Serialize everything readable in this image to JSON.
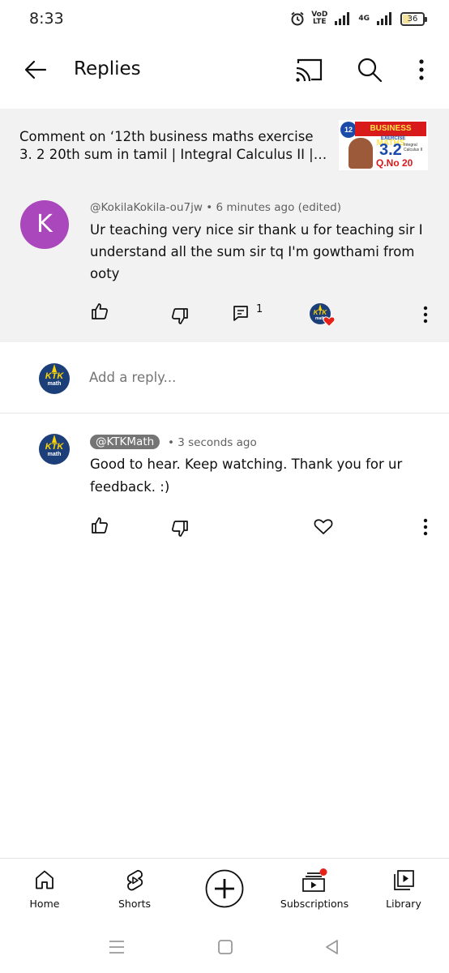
{
  "status_bar": {
    "time": "8:33",
    "volte_label_line1": "VoD",
    "volte_label_line2": "LTE",
    "network_label": "4G",
    "battery_level": "36"
  },
  "header": {
    "title": "Replies",
    "back_icon": "back-arrow-icon",
    "cast_icon": "cast-icon",
    "search_icon": "search-icon",
    "more_icon": "more-vertical-icon"
  },
  "video": {
    "context_line1": "Comment on  ‘12th business maths exercise",
    "context_line2": "3. 2 20th sum in tamil | Integral Calculus II | T...",
    "thumbnail": {
      "badge": "12",
      "banner": "BUSINESS MATHS",
      "exercise_label": "EXERCISE",
      "exercise_number": "3.2",
      "side_text": "Integral Calculus II",
      "question": "Q.No 20"
    }
  },
  "comment": {
    "avatar_letter": "K",
    "author": "@KokilaKokila-ou7jw",
    "meta": "• 6 minutes ago (edited)",
    "text": "Ur teaching very nice sir thank u for teaching sir I understand all the sum sir tq I'm gowthami from ooty",
    "reply_count": "1"
  },
  "add_reply": {
    "placeholder": "Add a reply..."
  },
  "channel_avatar": {
    "line1": "KTK",
    "line2": "math"
  },
  "reply": {
    "author": "@KTKMath",
    "time": "• 3 seconds ago",
    "text": "Good to hear.  Keep watching.  Thank you for ur feedback.  :)"
  },
  "bottom_nav": {
    "items": [
      {
        "label": "Home",
        "icon": "home-icon"
      },
      {
        "label": "Shorts",
        "icon": "shorts-icon"
      },
      {
        "label": "",
        "icon": "create-plus-icon"
      },
      {
        "label": "Subscriptions",
        "icon": "subscriptions-icon"
      },
      {
        "label": "Library",
        "icon": "library-icon"
      }
    ]
  },
  "colors": {
    "context_bg": "#f2f2f2",
    "avatar_purple": "#ab47bc",
    "channel_blue": "#1c3f7a",
    "heart_red": "#e62117",
    "notification_dot": "#e62117",
    "handle_bg": "#757575"
  }
}
